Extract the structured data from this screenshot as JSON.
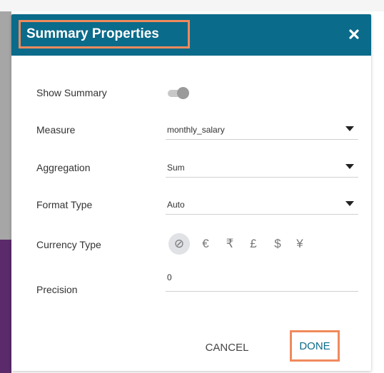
{
  "dialog": {
    "title": "Summary Properties",
    "close_icon": "close-icon",
    "accent_color": "#0b6b8a",
    "highlight_color": "#f08a5d"
  },
  "show_summary": {
    "label": "Show Summary",
    "enabled": true
  },
  "measure": {
    "label": "Measure",
    "value": "monthly_salary"
  },
  "aggregation": {
    "label": "Aggregation",
    "value": "Sum"
  },
  "format_type": {
    "label": "Format Type",
    "value": "Auto"
  },
  "currency_type": {
    "label": "Currency Type",
    "options": [
      {
        "symbol": "⊘",
        "name": "none",
        "selected": true
      },
      {
        "symbol": "€",
        "name": "euro",
        "selected": false
      },
      {
        "symbol": "₹",
        "name": "rupee",
        "selected": false
      },
      {
        "symbol": "£",
        "name": "pound",
        "selected": false
      },
      {
        "symbol": "$",
        "name": "dollar",
        "selected": false
      },
      {
        "symbol": "¥",
        "name": "yen",
        "selected": false
      }
    ]
  },
  "precision": {
    "label": "Precision",
    "value": "0"
  },
  "buttons": {
    "cancel": "CANCEL",
    "done": "DONE"
  }
}
